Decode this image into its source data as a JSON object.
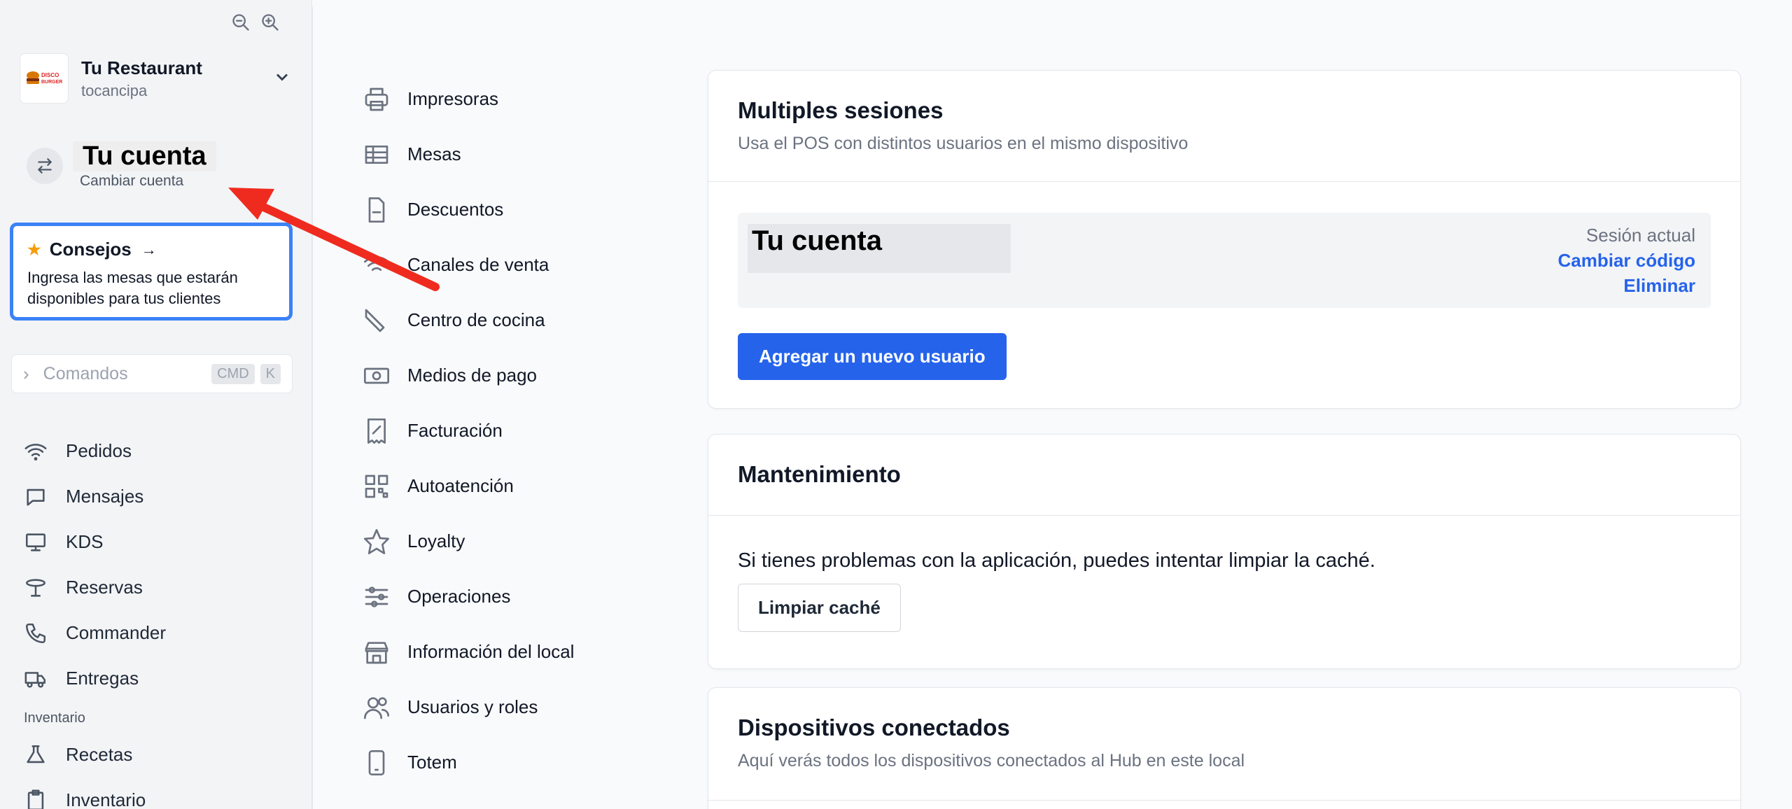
{
  "sidebar": {
    "zoom_out_icon": "zoom-out-icon",
    "zoom_in_icon": "zoom-in-icon",
    "restaurant": {
      "logo_text": "DISCO BURGER",
      "name": "Tu Restaurant",
      "location": "tocancipa"
    },
    "account": {
      "name": "Tu cuenta",
      "switch_label": "Cambiar cuenta"
    },
    "tips": {
      "title": "Consejos",
      "text": "Ingresa las mesas que estarán disponibles para tus clientes"
    },
    "commands": {
      "label": "Comandos",
      "kbd1": "CMD",
      "kbd2": "K"
    },
    "nav": [
      {
        "label": "Pedidos",
        "icon": "wifi-icon"
      },
      {
        "label": "Mensajes",
        "icon": "message-icon"
      },
      {
        "label": "KDS",
        "icon": "monitor-icon"
      },
      {
        "label": "Reservas",
        "icon": "table-icon"
      },
      {
        "label": "Commander",
        "icon": "phone-icon"
      },
      {
        "label": "Entregas",
        "icon": "truck-icon"
      }
    ],
    "inventory_section": "Inventario",
    "inventory_nav": [
      {
        "label": "Recetas",
        "icon": "flask-icon"
      },
      {
        "label": "Inventario",
        "icon": "clipboard-icon"
      }
    ]
  },
  "settings_menu": [
    {
      "label": "Impresoras",
      "icon": "printer-icon"
    },
    {
      "label": "Mesas",
      "icon": "table-grid-icon"
    },
    {
      "label": "Descuentos",
      "icon": "document-icon"
    },
    {
      "label": "Canales de venta",
      "icon": "wifi-icon"
    },
    {
      "label": "Centro de cocina",
      "icon": "knife-icon"
    },
    {
      "label": "Medios de pago",
      "icon": "banknote-icon"
    },
    {
      "label": "Facturación",
      "icon": "receipt-icon"
    },
    {
      "label": "Autoatención",
      "icon": "qr-icon"
    },
    {
      "label": "Loyalty",
      "icon": "star-icon"
    },
    {
      "label": "Operaciones",
      "icon": "sliders-icon"
    },
    {
      "label": "Información del local",
      "icon": "store-icon"
    },
    {
      "label": "Usuarios y roles",
      "icon": "users-icon"
    },
    {
      "label": "Totem",
      "icon": "tablet-icon"
    }
  ],
  "sessions": {
    "title": "Multiples sesiones",
    "subtitle": "Usa el POS con distintos usuarios en el mismo dispositivo",
    "user_name": "Tu cuenta",
    "current_label": "Sesión actual",
    "change_code": "Cambiar código",
    "delete": "Eliminar",
    "add_user": "Agregar un nuevo usuario"
  },
  "maintenance": {
    "title": "Mantenimiento",
    "text": "Si tienes problemas con la aplicación, puedes intentar limpiar la caché.",
    "clear_cache": "Limpiar caché"
  },
  "devices": {
    "title": "Dispositivos conectados",
    "subtitle": "Aquí verás todos los dispositivos conectados al Hub en este local"
  },
  "colors": {
    "accent": "#2563eb",
    "tips_border": "#3b82f6",
    "annotation_arrow": "#ef2b1f"
  }
}
